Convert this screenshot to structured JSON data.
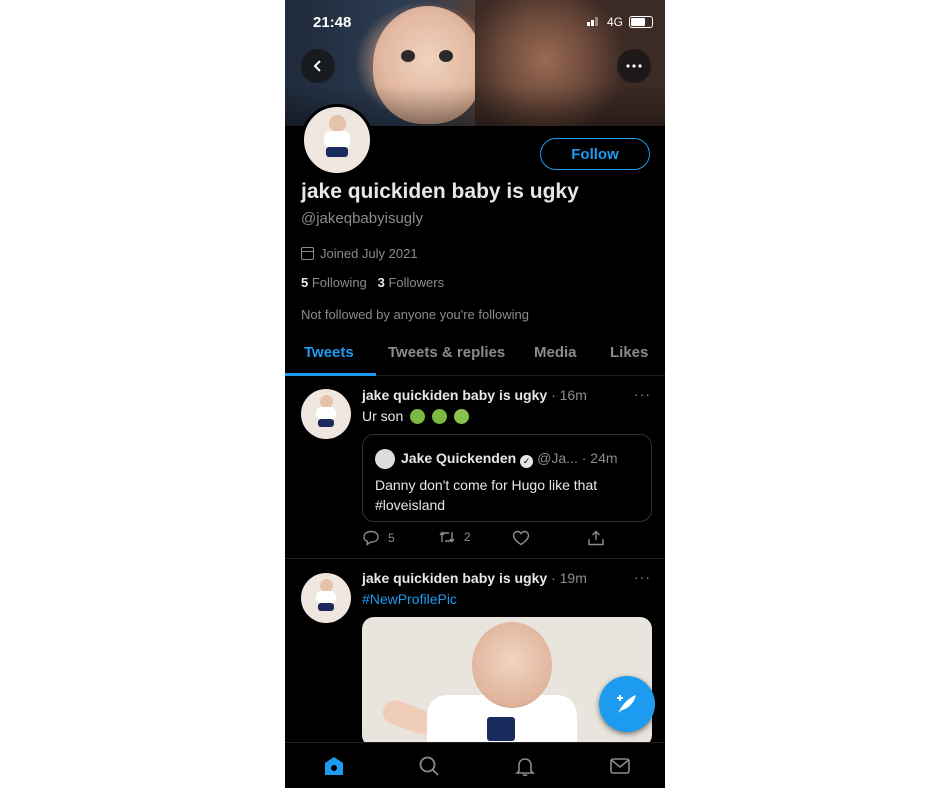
{
  "status_bar": {
    "time": "21:48",
    "network": "4G"
  },
  "profile": {
    "name": "jake quickiden baby is ugky",
    "handle": "@jakeqbabyisugly",
    "joined": "Joined July 2021",
    "following_count": "5",
    "following_label": "Following",
    "followers_count": "3",
    "followers_label": "Followers",
    "not_followed_text": "Not followed by anyone you're following",
    "follow_button": "Follow"
  },
  "tabs": [
    {
      "label": "Tweets",
      "active": true
    },
    {
      "label": "Tweets & replies",
      "active": false
    },
    {
      "label": "Media",
      "active": false
    },
    {
      "label": "Likes",
      "active": false
    }
  ],
  "tweets": [
    {
      "author": "jake quickiden baby is ugky",
      "time": "· 16m",
      "text": "Ur son",
      "emojis": [
        "nauseated-face",
        "nauseated-face",
        "vomiting-face"
      ],
      "quote": {
        "author": "Jake Quickenden",
        "handle": "@Ja...",
        "time": "· 24m",
        "text": "Danny don't come for Hugo like that #loveisland"
      },
      "replies": "5",
      "retweets": "2"
    },
    {
      "author": "jake quickiden baby is ugky",
      "time": "· 19m",
      "hashtag": "#NewProfilePic"
    }
  ],
  "colors": {
    "accent": "#1d9bf0",
    "background": "#000000",
    "muted": "#8b8b8b"
  },
  "icons": [
    "back-arrow-icon",
    "more-icon",
    "calendar-icon",
    "reply-icon",
    "retweet-icon",
    "like-icon",
    "share-icon",
    "compose-icon",
    "home-icon",
    "search-icon",
    "notifications-icon",
    "messages-icon"
  ]
}
